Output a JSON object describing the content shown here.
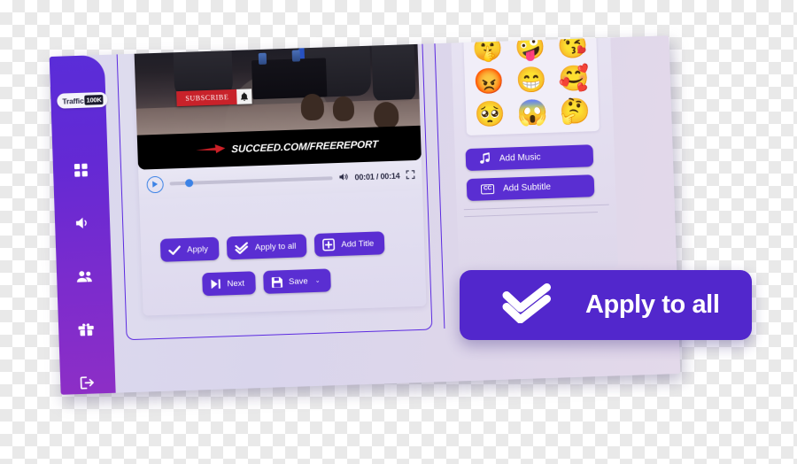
{
  "app": {
    "logo_word": "Traffic",
    "logo_badge": "100K"
  },
  "sidebar": {
    "items": [
      {
        "icon": "dashboard-grid-icon",
        "label": "Dashboard"
      },
      {
        "icon": "speaker-volume-icon",
        "label": "Audio"
      },
      {
        "icon": "users-people-icon",
        "label": "Members"
      },
      {
        "icon": "briefcase-box-icon",
        "label": "Products"
      },
      {
        "icon": "logout-exit-icon",
        "label": "Logout"
      }
    ]
  },
  "video": {
    "subscribe_label": "SUBSCRIBE",
    "bell_icon": "bell-icon",
    "caption_text": "SUCCEED.COM/FREEREPORT",
    "arrow_icon": "red-arrow-right-icon",
    "arrow_color": "#cc2027"
  },
  "player": {
    "play_icon": "play-icon",
    "volume_icon": "volume-icon",
    "fullscreen_icon": "fullscreen-icon",
    "timecode": "00:01 / 00:14",
    "current_time": "00:01",
    "duration": "00:14",
    "progress_percent": 12,
    "accent_color": "#3b82e6"
  },
  "actions": {
    "row1": [
      {
        "label": "Apply",
        "icon": "check-icon"
      },
      {
        "label": "Apply to all",
        "icon": "double-check-icon"
      },
      {
        "label": "Add Title",
        "icon": "plus-square-icon"
      }
    ],
    "row2": [
      {
        "label": "Next",
        "icon": "skip-next-icon",
        "chevron": ""
      },
      {
        "label": "Save",
        "icon": "floppy-save-icon",
        "chevron": "⌄"
      }
    ],
    "button_color": "#5a2ed2"
  },
  "right_panel": {
    "emojis": [
      "🤫",
      "🤪",
      "😘",
      "😡",
      "😁",
      "🥰",
      "🥺",
      "😱",
      "🤔"
    ],
    "buttons": [
      {
        "label": "Add Music",
        "icon": "music-note-icon"
      },
      {
        "label": "Add Subtitle",
        "icon": "closed-caption-icon",
        "cc_text": "CC"
      }
    ]
  },
  "callout": {
    "label": "Apply to all",
    "icon": "double-check-icon",
    "background": "#5227cc"
  }
}
